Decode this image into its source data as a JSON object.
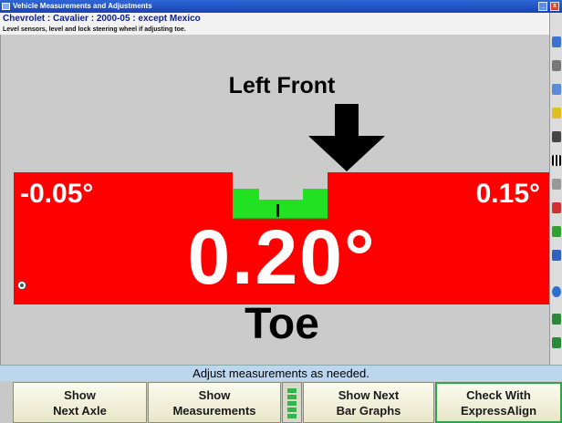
{
  "window": {
    "title": "Vehicle Measurements and Adjustments",
    "min_glyph": "_",
    "close_glyph": "x"
  },
  "vehicle": {
    "description": "Chevrolet : Cavalier : 2000-05 : except Mexico"
  },
  "instruction": "Level sensors, level and lock steering wheel if adjusting toe.",
  "measurement": {
    "heading": "Left Front",
    "min": "-0.05°",
    "max": "0.15°",
    "value": "0.20°",
    "label": "Toe",
    "colors": {
      "out_of_spec": "#ff0000",
      "in_spec": "#22e022",
      "background": "#cbcbcb"
    }
  },
  "toolbar": {
    "icons": [
      "help-icon",
      "printer-icon",
      "vehicle-icon",
      "target-icon",
      "camera-icon",
      "checkered-flag-icon",
      "wrench-icon",
      "sensor-icon",
      "settings-icon",
      "car-icon",
      "globe-icon",
      "power-icon",
      "bars-icon"
    ]
  },
  "status": "Adjust measurements as needed.",
  "buttons": [
    {
      "line1": "Show",
      "line2": "Next Axle"
    },
    {
      "line1": "Show",
      "line2": "Measurements"
    },
    {
      "line1": "Show Next",
      "line2": "Bar Graphs"
    },
    {
      "line1": "Check With",
      "line2": "ExpressAlign"
    }
  ]
}
